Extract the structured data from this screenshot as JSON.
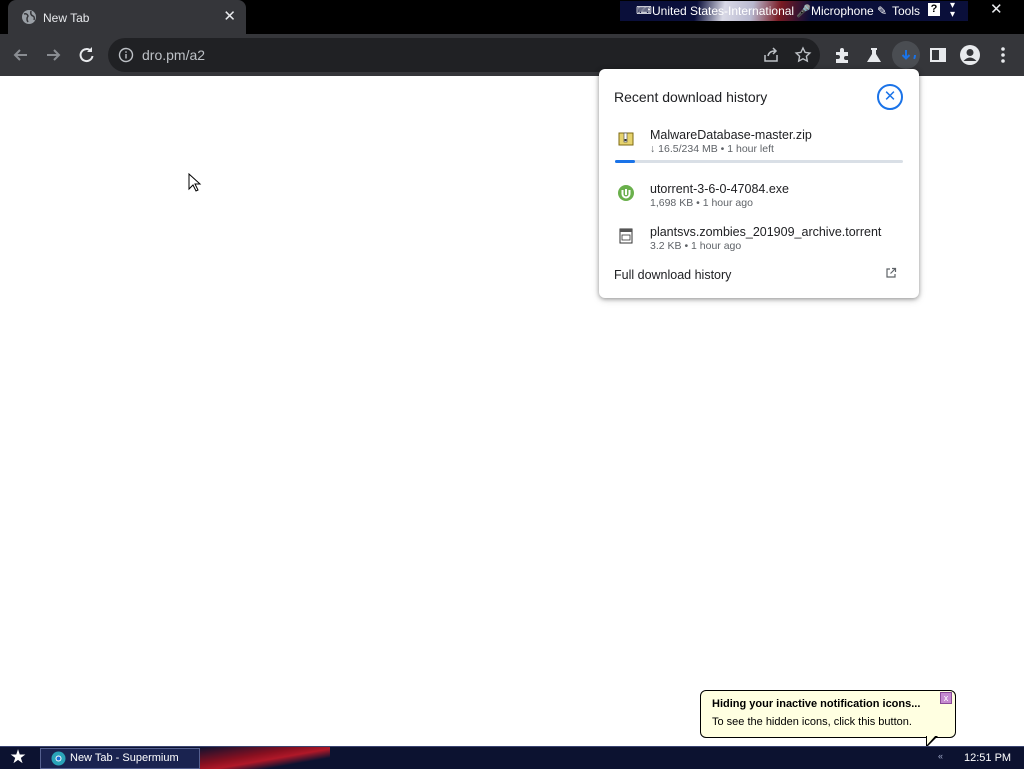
{
  "browser": {
    "tab_title": "New Tab",
    "tab_close": "✕",
    "url": "dro.pm/a2",
    "window_close": "✕"
  },
  "language_bar": {
    "language": "United States-International",
    "microphone": "Microphone",
    "tools": "Tools",
    "help": "?"
  },
  "download_panel": {
    "title": "Recent download history",
    "close": "✕",
    "items": [
      {
        "name": "MalwareDatabase-master.zip",
        "status": "↓ 16.5/234 MB • 1 hour left",
        "icon": "zip-file-icon",
        "progress_percent": 7
      },
      {
        "name": "utorrent-3-6-0-47084.exe",
        "status": "1,698 KB • 1 hour ago",
        "icon": "utorrent-icon"
      },
      {
        "name": "plantsvs.zombies_201909_archive.torrent",
        "status": "3.2 KB • 1 hour ago",
        "icon": "torrent-file-icon"
      }
    ],
    "full_history": "Full download history"
  },
  "notification": {
    "title": "Hiding your inactive notification icons...",
    "text": "To see the hidden icons, click this button.",
    "close": "x"
  },
  "taskbar": {
    "start": "★",
    "task_label": "New Tab - Supermium",
    "tray_arrow": "«",
    "clock": "12:51 PM"
  },
  "colors": {
    "chrome_dark": "#35363a",
    "omnibox": "#202124",
    "accent": "#1a73e8",
    "balloon": "#ffffe1",
    "taskbar": "#0c1230"
  }
}
